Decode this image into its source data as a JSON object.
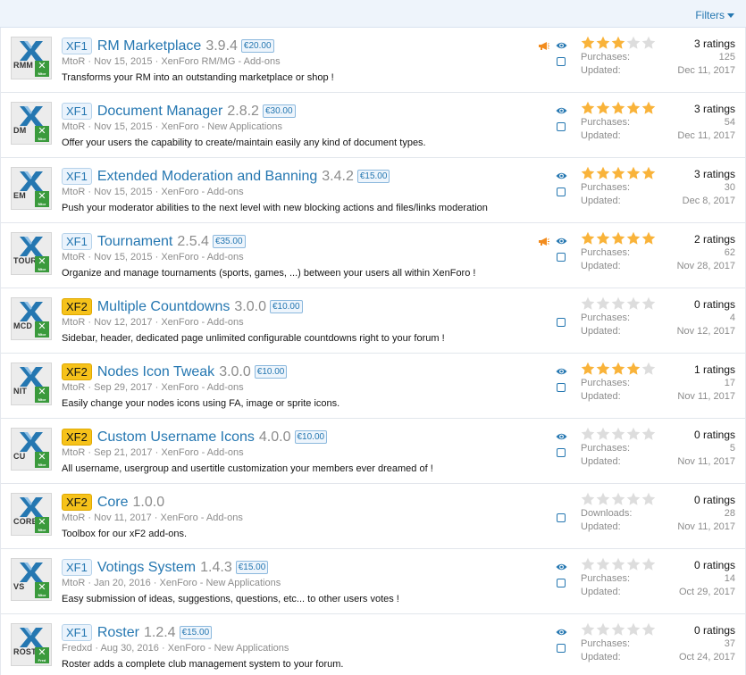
{
  "filters_label": "Filters",
  "colors": {
    "link": "#2577b1",
    "star_on": "#f9b33a",
    "star_off": "#dddddd",
    "xf2_tag": "#f6c21a",
    "warn_flag": "#f28c1e"
  },
  "resources": [
    {
      "abbr": "RMM",
      "badge": "Mtor",
      "version_tag": "XF1",
      "title": "RM Marketplace",
      "version": "3.9.4",
      "price": "€20.00",
      "author": "MtoR",
      "date": "Nov 15, 2015",
      "category": "XenForo RM/MG - Add-ons",
      "description": "Transforms your RM into an outstanding marketplace or shop !",
      "flag": true,
      "watch": true,
      "rating": 3,
      "ratings_text": "3 ratings",
      "stat1_label": "Purchases:",
      "stat1_value": "125",
      "stat2_label": "Updated:",
      "stat2_value": "Dec 11, 2017"
    },
    {
      "abbr": "DM",
      "badge": "Mtor",
      "version_tag": "XF1",
      "title": "Document Manager",
      "version": "2.8.2",
      "price": "€30.00",
      "author": "MtoR",
      "date": "Nov 15, 2015",
      "category": "XenForo - New Applications",
      "description": "Offer your users the capability to create/maintain easily any kind of document types.",
      "flag": false,
      "watch": true,
      "rating": 5,
      "ratings_text": "3 ratings",
      "stat1_label": "Purchases:",
      "stat1_value": "54",
      "stat2_label": "Updated:",
      "stat2_value": "Dec 11, 2017"
    },
    {
      "abbr": "EM",
      "badge": "Mtor",
      "version_tag": "XF1",
      "title": "Extended Moderation and Banning",
      "version": "3.4.2",
      "price": "€15.00",
      "author": "MtoR",
      "date": "Nov 15, 2015",
      "category": "XenForo - Add-ons",
      "description": "Push your moderator abilities to the next level with new blocking actions and files/links moderation",
      "flag": false,
      "watch": true,
      "rating": 5,
      "ratings_text": "3 ratings",
      "stat1_label": "Purchases:",
      "stat1_value": "30",
      "stat2_label": "Updated:",
      "stat2_value": "Dec 8, 2017"
    },
    {
      "abbr": "TOUR",
      "badge": "Mtor",
      "version_tag": "XF1",
      "title": "Tournament",
      "version": "2.5.4",
      "price": "€35.00",
      "author": "MtoR",
      "date": "Nov 15, 2015",
      "category": "XenForo - Add-ons",
      "description": "Organize and manage tournaments (sports, games, ...) between your users all within XenForo !",
      "flag": true,
      "watch": true,
      "rating": 5,
      "ratings_text": "2 ratings",
      "stat1_label": "Purchases:",
      "stat1_value": "62",
      "stat2_label": "Updated:",
      "stat2_value": "Nov 28, 2017"
    },
    {
      "abbr": "MCD",
      "badge": "Mtor",
      "version_tag": "XF2",
      "title": "Multiple Countdowns",
      "version": "3.0.0",
      "price": "€10.00",
      "author": "MtoR",
      "date": "Nov 12, 2017",
      "category": "XenForo - Add-ons",
      "description": "Sidebar, header, dedicated page unlimited configurable countdowns right to your forum !",
      "flag": false,
      "watch": false,
      "rating": 0,
      "ratings_text": "0 ratings",
      "stat1_label": "Purchases:",
      "stat1_value": "4",
      "stat2_label": "Updated:",
      "stat2_value": "Nov 12, 2017"
    },
    {
      "abbr": "NIT",
      "badge": "Mtor",
      "version_tag": "XF2",
      "title": "Nodes Icon Tweak",
      "version": "3.0.0",
      "price": "€10.00",
      "author": "MtoR",
      "date": "Sep 29, 2017",
      "category": "XenForo - Add-ons",
      "description": "Easily change your nodes icons using FA, image or sprite icons.",
      "flag": false,
      "watch": true,
      "rating": 4,
      "ratings_text": "1 ratings",
      "stat1_label": "Purchases:",
      "stat1_value": "17",
      "stat2_label": "Updated:",
      "stat2_value": "Nov 11, 2017"
    },
    {
      "abbr": "CU",
      "badge": "Mtor",
      "version_tag": "XF2",
      "title": "Custom Username Icons",
      "version": "4.0.0",
      "price": "€10.00",
      "author": "MtoR",
      "date": "Sep 21, 2017",
      "category": "XenForo - Add-ons",
      "description": "All username, usergroup and usertitle customization your members ever dreamed of !",
      "flag": false,
      "watch": true,
      "rating": 0,
      "ratings_text": "0 ratings",
      "stat1_label": "Purchases:",
      "stat1_value": "5",
      "stat2_label": "Updated:",
      "stat2_value": "Nov 11, 2017"
    },
    {
      "abbr": "CORE",
      "badge": "Mtor",
      "version_tag": "XF2",
      "title": "Core",
      "version": "1.0.0",
      "price": "",
      "author": "MtoR",
      "date": "Nov 11, 2017",
      "category": "XenForo - Add-ons",
      "description": "Toolbox for our xF2 add-ons.",
      "flag": false,
      "watch": false,
      "rating": 0,
      "ratings_text": "0 ratings",
      "stat1_label": "Downloads:",
      "stat1_value": "28",
      "stat2_label": "Updated:",
      "stat2_value": "Nov 11, 2017"
    },
    {
      "abbr": "VS",
      "badge": "Mtor",
      "version_tag": "XF1",
      "title": "Votings System",
      "version": "1.4.3",
      "price": "€15.00",
      "author": "MtoR",
      "date": "Jan 20, 2016",
      "category": "XenForo - New Applications",
      "description": "Easy submission of ideas, suggestions, questions, etc... to other users votes !",
      "flag": false,
      "watch": true,
      "rating": 0,
      "ratings_text": "0 ratings",
      "stat1_label": "Purchases:",
      "stat1_value": "14",
      "stat2_label": "Updated:",
      "stat2_value": "Oct 29, 2017"
    },
    {
      "abbr": "ROST",
      "badge": "Fred",
      "version_tag": "XF1",
      "title": "Roster",
      "version": "1.2.4",
      "price": "€15.00",
      "author": "Fredxd",
      "date": "Aug 30, 2016",
      "category": "XenForo - New Applications",
      "description": "Roster adds a complete club management system to your forum.",
      "flag": false,
      "watch": true,
      "rating": 0,
      "ratings_text": "0 ratings",
      "stat1_label": "Purchases:",
      "stat1_value": "37",
      "stat2_label": "Updated:",
      "stat2_value": "Oct 24, 2017"
    }
  ]
}
